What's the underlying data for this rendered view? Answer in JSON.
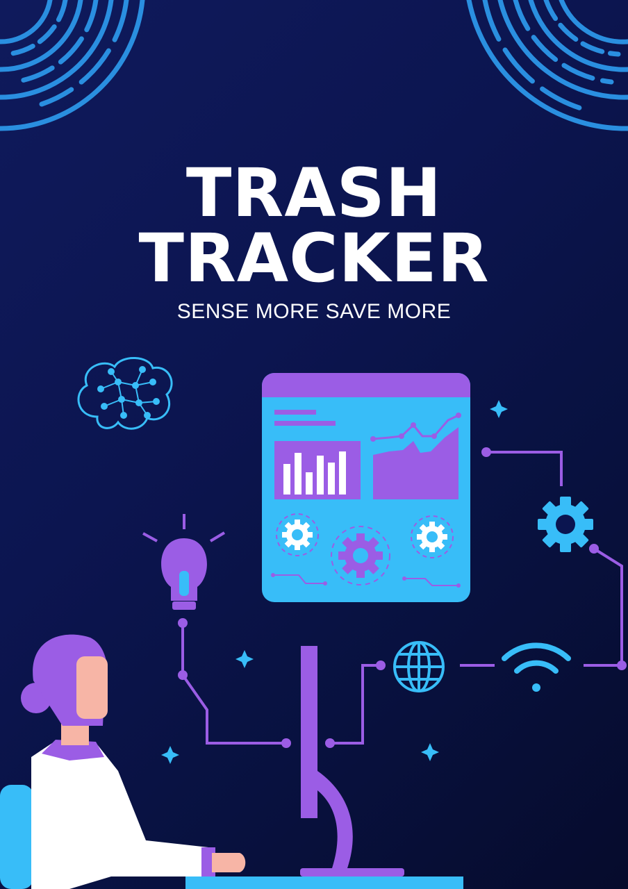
{
  "poster": {
    "title_line1": "TRASH",
    "title_line2": "TRACKER",
    "tagline": "SENSE MORE SAVE MORE"
  },
  "icons": [
    "concentric-arcs-icon",
    "brain-network-icon",
    "dashboard-screen-icon",
    "bar-chart-icon",
    "area-chart-icon",
    "gear-icon",
    "lightbulb-icon",
    "globe-icon",
    "wifi-icon",
    "sparkle-icon",
    "monitor-stand-icon",
    "person-illustration"
  ],
  "colors": {
    "background": "#0c1550",
    "cyan": "#38bdf8",
    "purple": "#9b5de5",
    "skin": "#f7b5a6",
    "white": "#ffffff"
  }
}
